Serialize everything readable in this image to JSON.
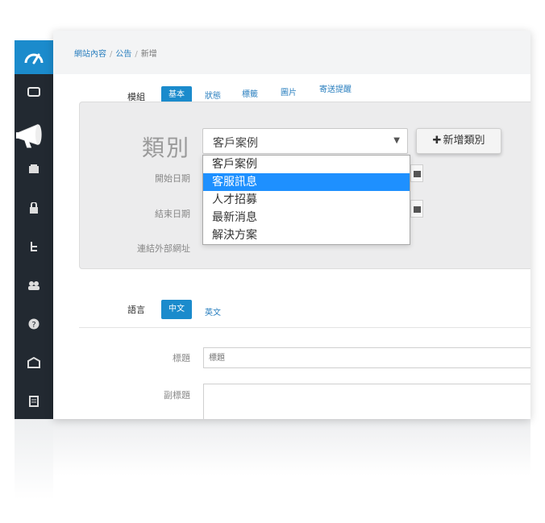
{
  "breadcrumb": {
    "items": [
      "網站內容",
      "公告",
      "新增"
    ],
    "separator": "/"
  },
  "module": {
    "label": "模組",
    "tabs": [
      {
        "label": "基本",
        "active": true
      },
      {
        "label": "狀態",
        "active": false
      },
      {
        "label": "標籤",
        "active": false
      },
      {
        "label": "圖片",
        "active": false
      },
      {
        "label": "寄送提醒",
        "active": false
      }
    ]
  },
  "category": {
    "label": "類別",
    "selected": "客戶案例",
    "options": [
      "客戶案例",
      "客服訊息",
      "人才招募",
      "最新消息",
      "解決方案"
    ],
    "highlighted": "客服訊息",
    "add_button": "新增類別"
  },
  "fields": {
    "start_date": "開始日期",
    "end_date": "結束日期",
    "external_url": "連結外部網址"
  },
  "language": {
    "label": "語言",
    "tabs": [
      {
        "label": "中文",
        "active": true
      },
      {
        "label": "英文",
        "active": false
      }
    ]
  },
  "content": {
    "title_label": "標題",
    "title_placeholder": "標題",
    "subtitle_label": "副標題"
  },
  "colors": {
    "accent": "#1b8bcc",
    "sidebar": "#222931",
    "highlight": "#1e90ff"
  },
  "sidebar_icons": [
    "dashboard-gauge-icon",
    "window-icon",
    "megaphone-icon",
    "inbox-icon",
    "lock-icon",
    "sitemap-icon",
    "users-icon",
    "help-icon",
    "store-icon",
    "document-icon"
  ]
}
